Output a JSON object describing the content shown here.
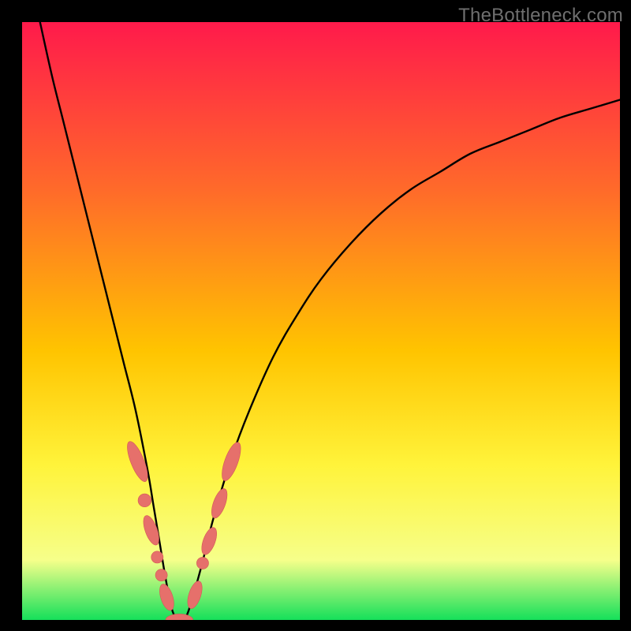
{
  "watermark": {
    "text": "TheBottleneck.com"
  },
  "colors": {
    "page_bg": "#000000",
    "grad_top": "#ff1a4b",
    "grad_mid_upper": "#ff6a2a",
    "grad_mid": "#ffc400",
    "grad_mid_lower": "#fff33a",
    "grad_low": "#f6ff8a",
    "grad_bottom": "#15e05a",
    "curve_stroke": "#000000",
    "marker_fill": "#e6706b",
    "marker_stroke": "#d35a55"
  },
  "chart_data": {
    "type": "line",
    "title": "",
    "xlabel": "",
    "ylabel": "",
    "xlim": [
      0,
      100
    ],
    "ylim": [
      0,
      100
    ],
    "grid": false,
    "series": [
      {
        "name": "bottleneck-curve",
        "x": [
          3,
          5,
          7,
          9,
          11,
          13,
          15,
          17,
          19,
          21,
          22,
          23,
          24,
          25,
          26,
          27,
          28,
          30,
          32,
          35,
          38,
          42,
          46,
          50,
          55,
          60,
          65,
          70,
          75,
          80,
          85,
          90,
          95,
          100
        ],
        "y": [
          100,
          91,
          83,
          75,
          67,
          59,
          51,
          43,
          35,
          25,
          19,
          13,
          7,
          2,
          0,
          0,
          2,
          9,
          17,
          27,
          35,
          44,
          51,
          57,
          63,
          68,
          72,
          75,
          78,
          80,
          82,
          84,
          85.5,
          87
        ]
      }
    ],
    "markers": [
      {
        "shape": "pill",
        "cx": 19.3,
        "cy": 26.5,
        "rx": 1.1,
        "ry": 3.6,
        "angle": -22
      },
      {
        "shape": "circle",
        "cx": 20.5,
        "cy": 20.0,
        "r": 1.1
      },
      {
        "shape": "pill",
        "cx": 21.6,
        "cy": 15.0,
        "rx": 1.0,
        "ry": 2.6,
        "angle": -20
      },
      {
        "shape": "circle",
        "cx": 22.6,
        "cy": 10.5,
        "r": 1.0
      },
      {
        "shape": "circle",
        "cx": 23.3,
        "cy": 7.5,
        "r": 1.0
      },
      {
        "shape": "pill",
        "cx": 24.2,
        "cy": 3.8,
        "rx": 1.0,
        "ry": 2.3,
        "angle": -18
      },
      {
        "shape": "pill",
        "cx": 26.3,
        "cy": 0.0,
        "rx": 2.3,
        "ry": 1.0,
        "angle": 0
      },
      {
        "shape": "pill",
        "cx": 28.9,
        "cy": 4.2,
        "rx": 1.0,
        "ry": 2.4,
        "angle": 18
      },
      {
        "shape": "circle",
        "cx": 30.2,
        "cy": 9.5,
        "r": 1.0
      },
      {
        "shape": "pill",
        "cx": 31.3,
        "cy": 13.2,
        "rx": 1.0,
        "ry": 2.4,
        "angle": 20
      },
      {
        "shape": "pill",
        "cx": 33.0,
        "cy": 19.5,
        "rx": 1.0,
        "ry": 2.6,
        "angle": 20
      },
      {
        "shape": "pill",
        "cx": 35.0,
        "cy": 26.5,
        "rx": 1.1,
        "ry": 3.4,
        "angle": 20
      }
    ]
  }
}
